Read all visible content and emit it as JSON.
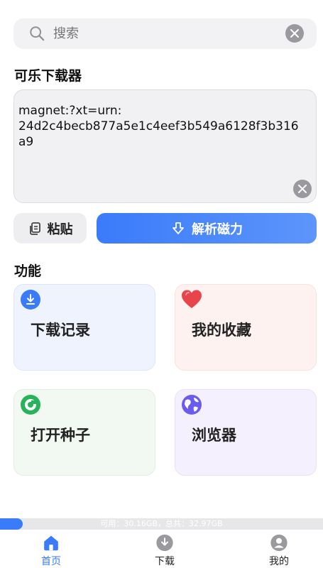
{
  "search": {
    "placeholder": "搜索"
  },
  "app_title": "可乐下载器",
  "magnet": {
    "value": "magnet:?xt=urn:\n24d2c4becb877a5e1c4eef3b549a6128f3b316a9"
  },
  "buttons": {
    "paste": "粘贴",
    "parse": "解析磁力"
  },
  "features": {
    "title": "功能",
    "items": [
      {
        "label": "下载记录",
        "icon": "download-circle-icon"
      },
      {
        "label": "我的收藏",
        "icon": "heart-icon"
      },
      {
        "label": "打开种子",
        "icon": "torrent-icon"
      },
      {
        "label": "浏览器",
        "icon": "globe-icon"
      }
    ]
  },
  "storage": {
    "text": "可用：30.16GB，总共：32.97GB",
    "used_fraction": 0.07
  },
  "tabs": [
    {
      "label": "首页",
      "active": true
    },
    {
      "label": "下载",
      "active": false
    },
    {
      "label": "我的",
      "active": false
    }
  ],
  "colors": {
    "accent": "#3a7bfa",
    "favorite": "#e8454b",
    "torrent": "#28b35a",
    "browser": "#6b5cf0"
  }
}
